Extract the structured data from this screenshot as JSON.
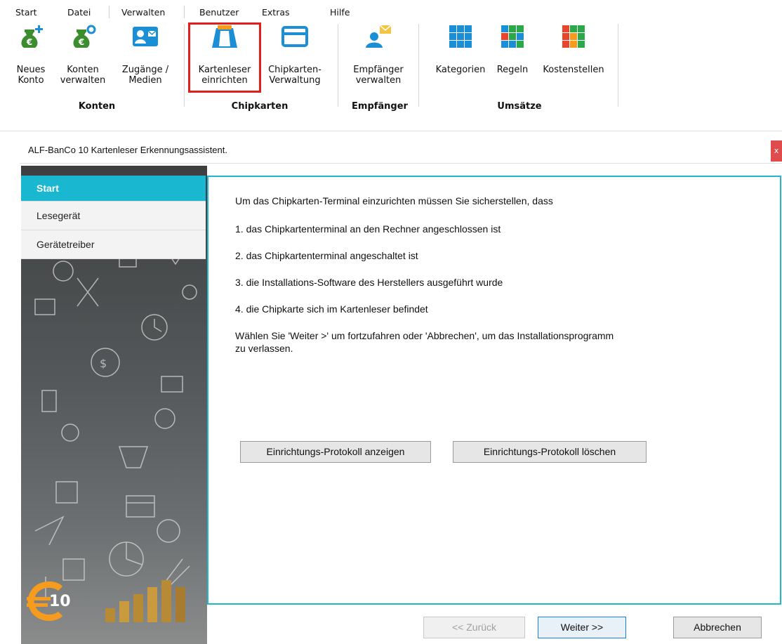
{
  "menu": [
    "Start",
    "Datei",
    "Verwalten",
    "Benutzer",
    "Extras",
    "Hilfe"
  ],
  "ribbon": {
    "buttons": [
      {
        "label": "Neues\nKonto",
        "icon": "money-bag-plus-icon"
      },
      {
        "label": "Konten\nverwalten",
        "icon": "money-bag-gear-icon"
      },
      {
        "label": "Zugänge /\nMedien",
        "icon": "contact-card-icon"
      },
      {
        "label": "Kartenleser\neinrichten",
        "icon": "card-reader-icon"
      },
      {
        "label": "Chipkarten-\nVerwaltung",
        "icon": "credit-card-icon"
      },
      {
        "label": "Empfänger\nverwalten",
        "icon": "person-mail-icon"
      },
      {
        "label": "Kategorien",
        "icon": "category-grid-icon"
      },
      {
        "label": "Regeln",
        "icon": "rules-grid-icon"
      },
      {
        "label": "Kostenstellen",
        "icon": "cost-grid-icon"
      }
    ],
    "groups": [
      "Konten",
      "Chipkarten",
      "Empfänger",
      "Umsätze"
    ]
  },
  "dialog": {
    "title": "ALF-BanCo 10 Kartenleser Erkennungsassistent.",
    "close": "x",
    "nav": [
      "Start",
      "Lesegerät",
      "Gerätetreiber"
    ],
    "logo_text": "10",
    "intro": "Um das Chipkarten-Terminal einzurichten müssen Sie sicherstellen, dass",
    "steps": [
      "1. das Chipkartenterminal an den Rechner angeschlossen ist",
      "2. das Chipkartenterminal angeschaltet ist",
      "3. die Installations-Software des Herstellers ausgeführt wurde",
      "4. die Chipkarte sich im Kartenleser befindet"
    ],
    "hint_line1": "Wählen Sie 'Weiter >' um fortzufahren oder 'Abbrechen', um das Installationsprogramm",
    "hint_line2": "zu verlassen.",
    "buttons": {
      "show_log": "Einrichtungs-Protokoll anzeigen",
      "delete_log": "Einrichtungs-Protokoll löschen",
      "back": "<< Zurück",
      "next": "Weiter >>",
      "cancel": "Abbrechen"
    }
  },
  "colors": {
    "accent": "#1ab7d0",
    "highlight": "#e31c1c",
    "icon_blue": "#1a8fd6",
    "money_green": "#3b8d2e"
  }
}
